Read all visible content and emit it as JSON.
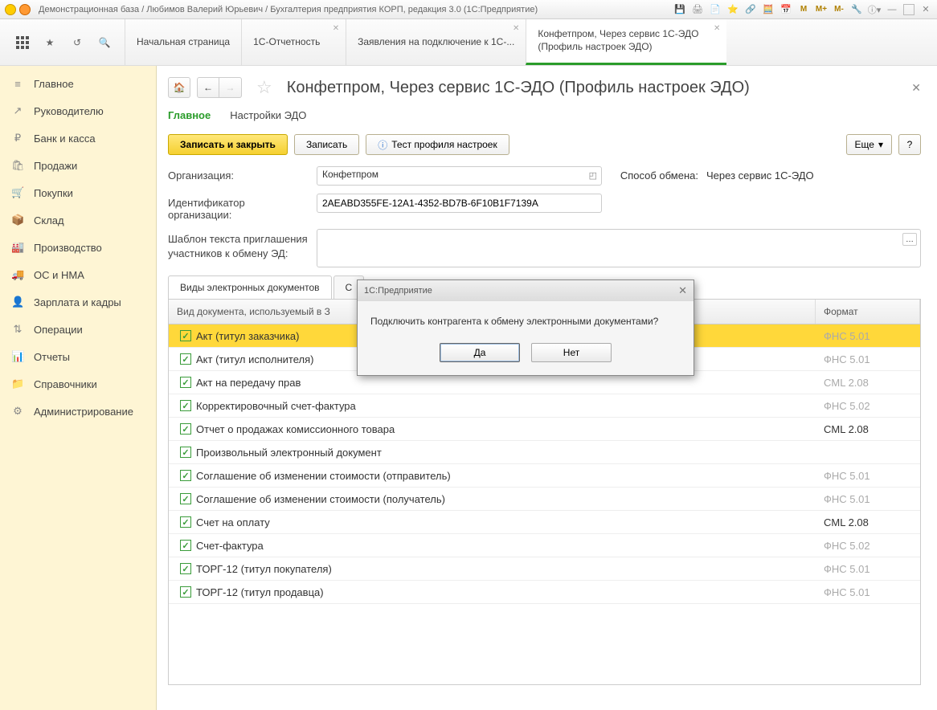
{
  "titlebar": {
    "title": "Демонстрационная база / Любимов Валерий Юрьевич / Бухгалтерия предприятия КОРП, редакция 3.0  (1С:Предприятие)",
    "m1": "M",
    "m2": "M+",
    "m3": "M-"
  },
  "tabs": [
    {
      "label": "Начальная страница"
    },
    {
      "label": "1С-Отчетность"
    },
    {
      "label": "Заявления на подключение к 1С-..."
    },
    {
      "label": "Конфетпром, Через сервис 1С-ЭДО (Профиль настроек ЭДО)"
    }
  ],
  "sidebar": [
    {
      "icon": "≡",
      "label": "Главное"
    },
    {
      "icon": "↗",
      "label": "Руководителю"
    },
    {
      "icon": "₽",
      "label": "Банк и касса"
    },
    {
      "icon": "🛍",
      "label": "Продажи"
    },
    {
      "icon": "🛒",
      "label": "Покупки"
    },
    {
      "icon": "📦",
      "label": "Склад"
    },
    {
      "icon": "🏭",
      "label": "Производство"
    },
    {
      "icon": "🚚",
      "label": "ОС и НМА"
    },
    {
      "icon": "👤",
      "label": "Зарплата и кадры"
    },
    {
      "icon": "⇅",
      "label": "Операции"
    },
    {
      "icon": "📊",
      "label": "Отчеты"
    },
    {
      "icon": "📁",
      "label": "Справочники"
    },
    {
      "icon": "⚙",
      "label": "Администрирование"
    }
  ],
  "page": {
    "title": "Конфетпром, Через сервис 1С-ЭДО (Профиль настроек ЭДО)",
    "subtab_main": "Главное",
    "subtab_edo": "Настройки ЭДО",
    "btn_save_close": "Записать и закрыть",
    "btn_save": "Записать",
    "btn_test": "Тест профиля настроек",
    "btn_more": "Еще",
    "btn_help": "?",
    "lbl_org": "Организация:",
    "val_org": "Конфетпром",
    "lbl_exch": "Способ обмена:",
    "val_exch": "Через сервис 1С-ЭДО",
    "lbl_id": "Идентификатор организации:",
    "val_id": "2AEABD355FE-12A1-4352-BD7B-6F10B1F7139A",
    "lbl_template": "Шаблон текста приглашения участников к обмену ЭД:",
    "itab1": "Виды электронных документов",
    "itab2": "С",
    "th_doc": "Вид документа, используемый в З",
    "th_fmt": "Формат"
  },
  "rows": [
    {
      "name": "Акт (титул заказчика)",
      "fmt": "ФНС 5.01",
      "sel": true,
      "dim": true
    },
    {
      "name": "Акт (титул исполнителя)",
      "fmt": "ФНС 5.01",
      "dim": true
    },
    {
      "name": "Акт на передачу прав",
      "fmt": "CML 2.08",
      "dim": true
    },
    {
      "name": "Корректировочный счет-фактура",
      "fmt": "ФНС 5.02",
      "dim": true
    },
    {
      "name": "Отчет о продажах комиссионного товара",
      "fmt": "CML 2.08",
      "dim": false
    },
    {
      "name": "Произвольный электронный документ",
      "fmt": "",
      "dim": true
    },
    {
      "name": "Соглашение об изменении стоимости (отправитель)",
      "fmt": "ФНС 5.01",
      "dim": true
    },
    {
      "name": "Соглашение об изменении стоимости (получатель)",
      "fmt": "ФНС 5.01",
      "dim": true
    },
    {
      "name": "Счет на оплату",
      "fmt": "CML 2.08",
      "dim": false
    },
    {
      "name": "Счет-фактура",
      "fmt": "ФНС 5.02",
      "dim": true
    },
    {
      "name": "ТОРГ-12 (титул покупателя)",
      "fmt": "ФНС 5.01",
      "dim": true
    },
    {
      "name": "ТОРГ-12 (титул продавца)",
      "fmt": "ФНС 5.01",
      "dim": true
    }
  ],
  "dialog": {
    "title": "1С:Предприятие",
    "msg": "Подключить контрагента к обмену электронными документами?",
    "yes": "Да",
    "no": "Нет"
  }
}
